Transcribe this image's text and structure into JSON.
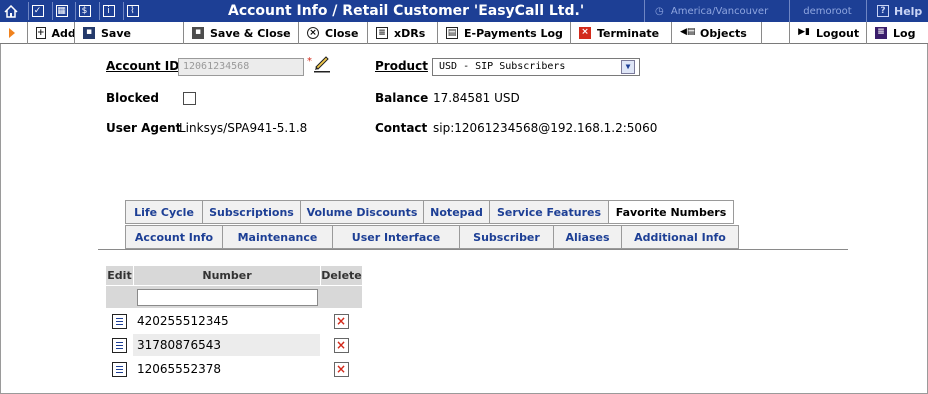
{
  "titlebar": {
    "title": "Account Info / Retail Customer 'EasyCall Ltd.'",
    "timezone": " America/Vancouver",
    "user": "demoroot",
    "help": "Help"
  },
  "toolbar": {
    "add": "Add",
    "save": "Save",
    "save_close": "Save & Close",
    "close": "Close",
    "xdrs": "xDRs",
    "epayments": "E-Payments Log",
    "terminate": "Terminate",
    "objects": "Objects",
    "logout": "Logout",
    "log": "Log"
  },
  "form": {
    "account_id_label": "Account ID",
    "account_id_value": "12061234568",
    "product_label": "Product",
    "product_value": "USD - SIP Subscribers",
    "blocked_label": "Blocked",
    "blocked_checked": false,
    "balance_label": "Balance",
    "balance_value": "17.84581 USD",
    "user_agent_label": "User Agent",
    "user_agent_value": "Linksys/SPA941-5.1.8",
    "contact_label": "Contact",
    "contact_value": "sip:12061234568@192.168.1.2:5060"
  },
  "tabs": {
    "row1": [
      "Life Cycle",
      "Subscriptions",
      "Volume Discounts",
      "Notepad",
      "Service Features",
      "Favorite Numbers"
    ],
    "row2": [
      "Account Info",
      "Maintenance",
      "User Interface",
      "Subscriber",
      "Aliases",
      "Additional Info"
    ],
    "active": "Favorite Numbers"
  },
  "favorites": {
    "headers": {
      "edit": "Edit",
      "number": "Number",
      "delete": "Delete"
    },
    "new_number": "",
    "rows": [
      {
        "number": "420255512345"
      },
      {
        "number": "31780876543"
      },
      {
        "number": "12065552378"
      }
    ]
  },
  "colors": {
    "titlebar_bg": "#1d3f95",
    "link_blue": "#1d3f95",
    "delete_red": "#d22a1b",
    "arrow_orange": "#f0821e"
  }
}
